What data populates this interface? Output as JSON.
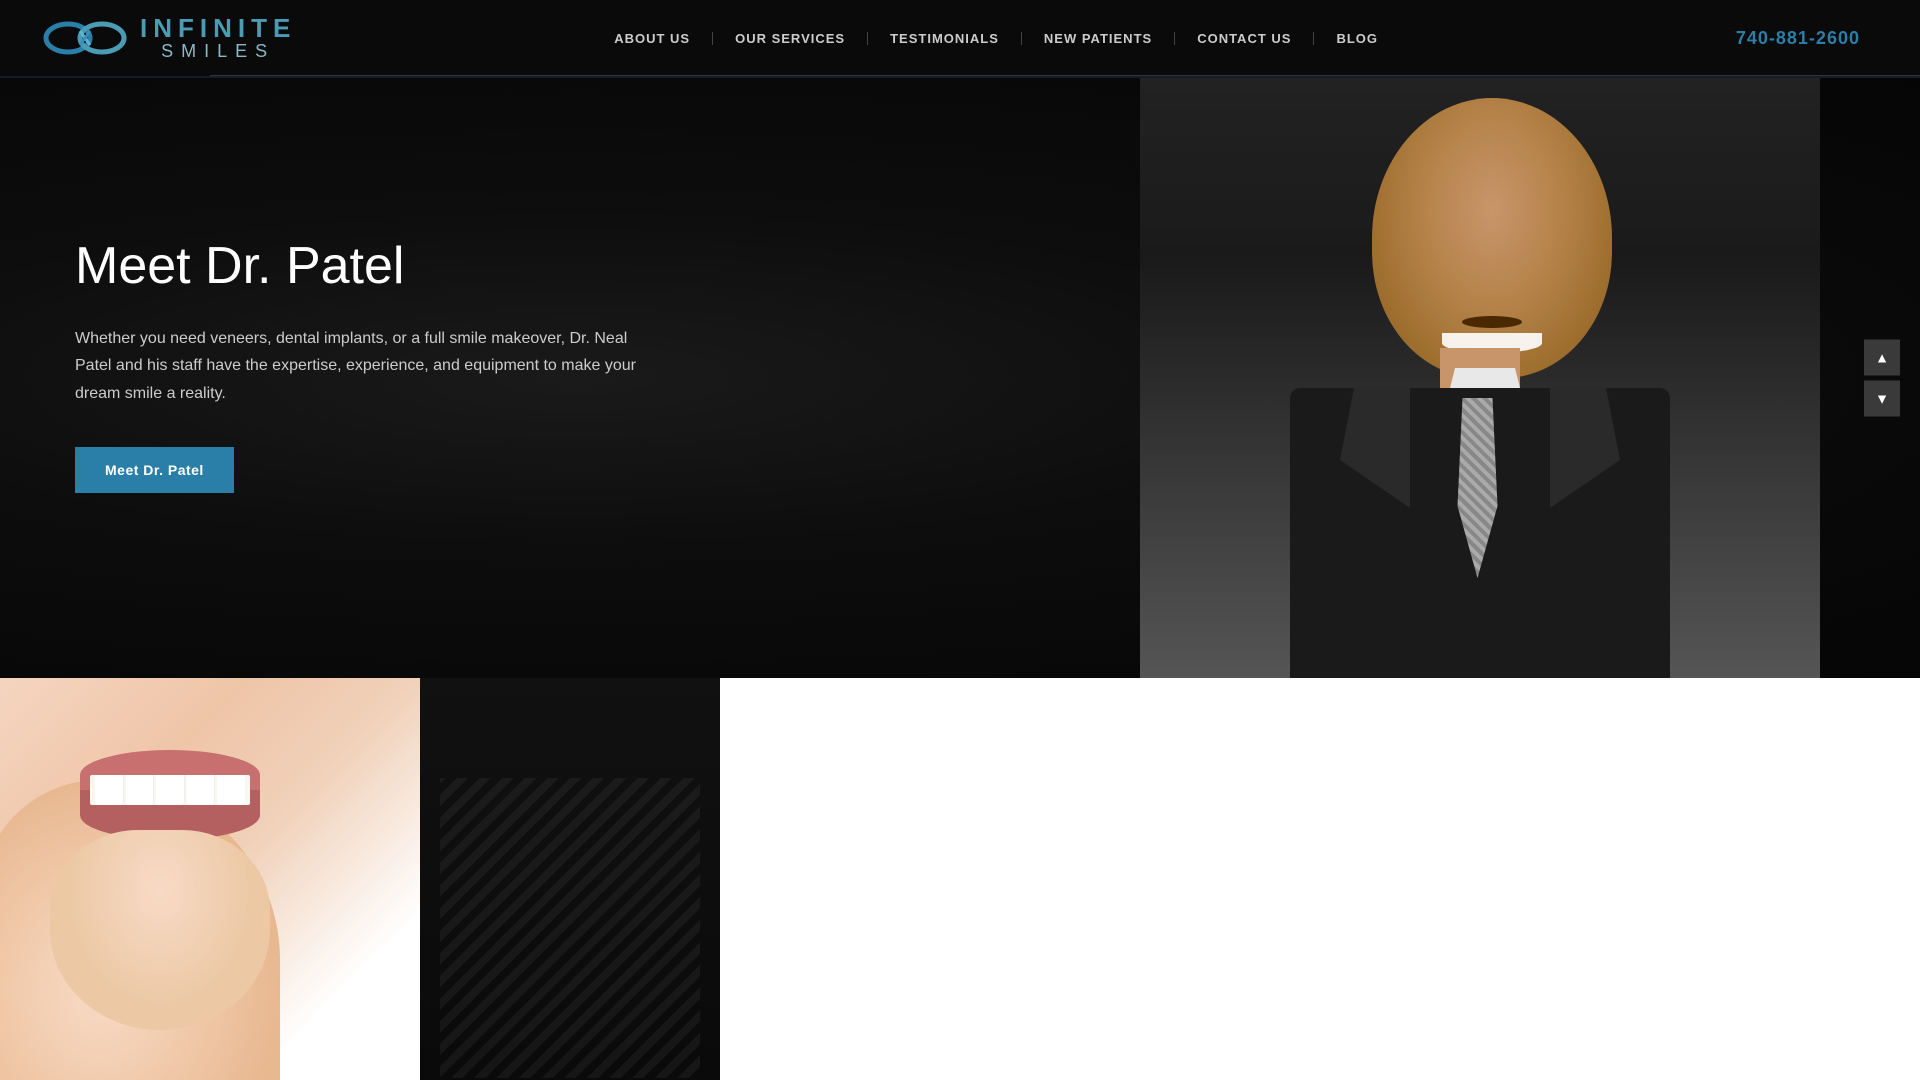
{
  "header": {
    "logo": {
      "infinite_text": "INFINITE",
      "smiles_text": "SMILES"
    },
    "nav": {
      "items": [
        {
          "label": "ABOUT US",
          "id": "about-us"
        },
        {
          "label": "OUR SERVICES",
          "id": "our-services"
        },
        {
          "label": "TESTIMONIALS",
          "id": "testimonials"
        },
        {
          "label": "NEW PATIENTS",
          "id": "new-patients"
        },
        {
          "label": "CONTACT US",
          "id": "contact-us"
        },
        {
          "label": "BLOG",
          "id": "blog"
        }
      ]
    },
    "phone": "740-881-2600"
  },
  "hero": {
    "title": "Meet Dr. Patel",
    "description": "Whether you need veneers, dental implants, or a full smile makeover, Dr. Neal Patel and his staff have the expertise, experience, and equipment to make your dream smile a reality.",
    "cta_button": "Meet Dr. Patel",
    "scroll_up": "▲",
    "scroll_down": "▼"
  },
  "colors": {
    "accent_blue": "#2a7fa8",
    "nav_text": "#cccccc",
    "header_bg": "#0a0a0a",
    "hero_bg": "#111111",
    "button_bg": "#2a7fa8",
    "phone_color": "#2a7fa8"
  }
}
